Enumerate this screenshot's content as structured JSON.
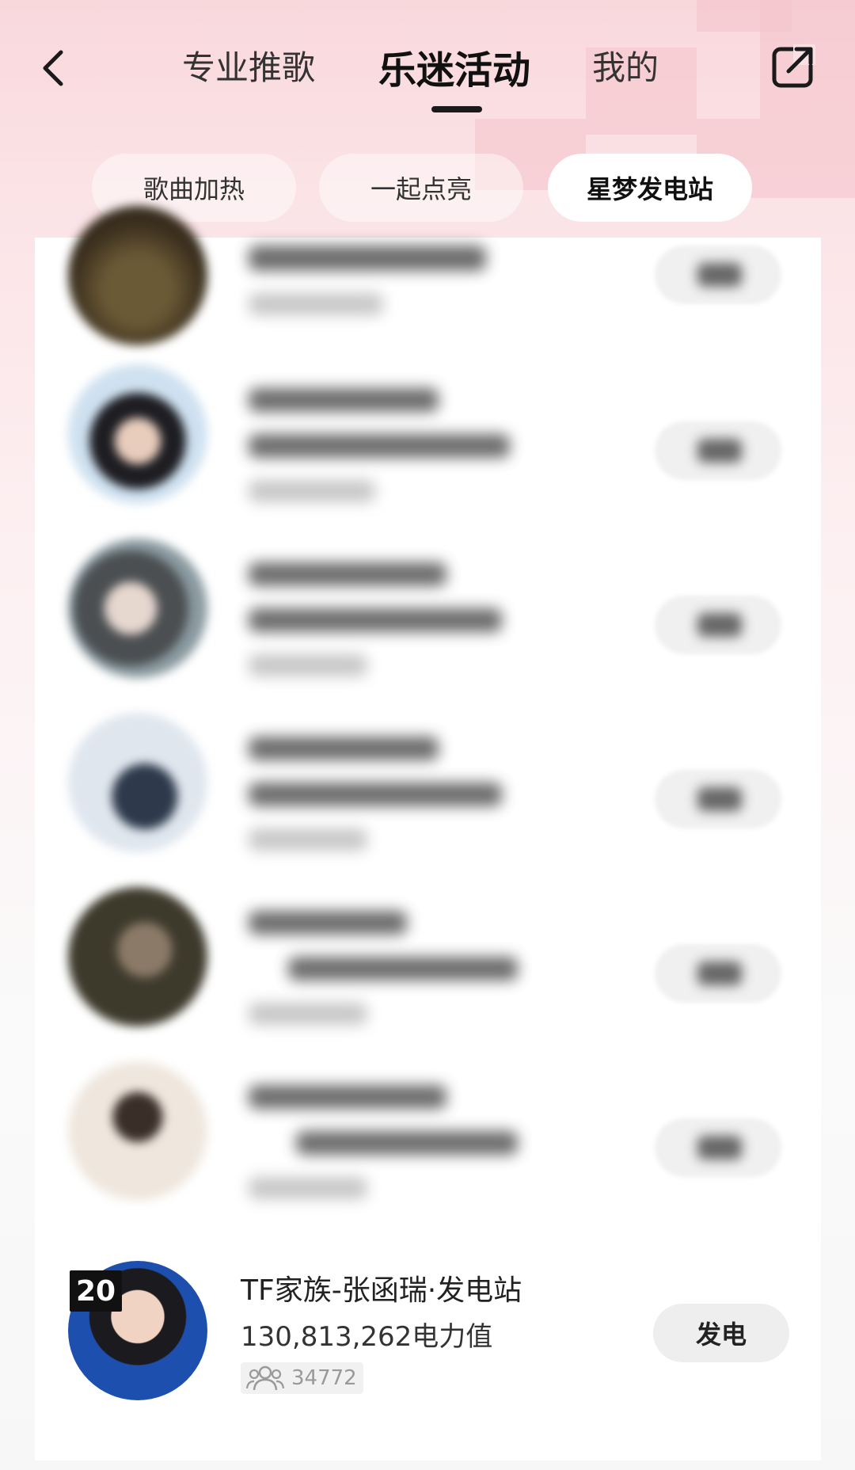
{
  "header": {
    "tabs": [
      {
        "label": "专业推歌"
      },
      {
        "label": "乐迷活动"
      },
      {
        "label": "我的"
      }
    ],
    "active_tab": "乐迷活动"
  },
  "subtabs": [
    {
      "label": "歌曲加热"
    },
    {
      "label": "一起点亮"
    },
    {
      "label": "星梦发电站"
    }
  ],
  "active_subtab": "星梦发电站",
  "featured_entry": {
    "rank": "20",
    "name": "TF家族-张函瑞·发电站",
    "power": "130,813,262电力值",
    "fans": "34772",
    "button": "发电"
  },
  "icons": {
    "back": "chevron-left-icon",
    "share": "share-external-icon",
    "fans": "people-icon"
  },
  "colors": {
    "accent_pink": "#f4c3ca",
    "text_dark": "#111111"
  }
}
